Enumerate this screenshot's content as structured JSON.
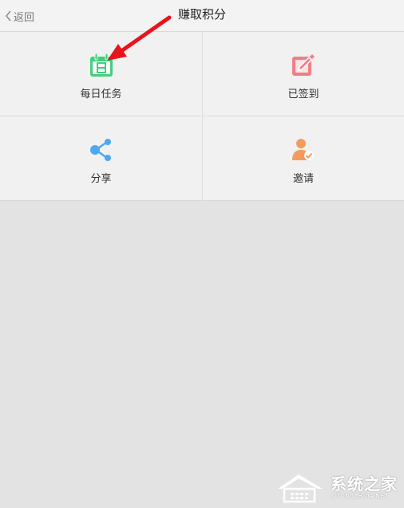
{
  "header": {
    "back_label": "返回",
    "title": "赚取积分"
  },
  "grid": {
    "items": [
      {
        "label": "每日任务",
        "icon": "calendar-icon",
        "color": "#3ed07a"
      },
      {
        "label": "已签到",
        "icon": "edit-icon",
        "color": "#ef7f86"
      },
      {
        "label": "分享",
        "icon": "share-icon",
        "color": "#4ea8ef"
      },
      {
        "label": "邀请",
        "icon": "invite-user-icon",
        "color": "#f59a5c"
      }
    ]
  },
  "annotation": {
    "color": "#e8141c"
  },
  "watermark": {
    "text": "系统之家",
    "subtext": "XITONGZHIJIA.NET"
  }
}
